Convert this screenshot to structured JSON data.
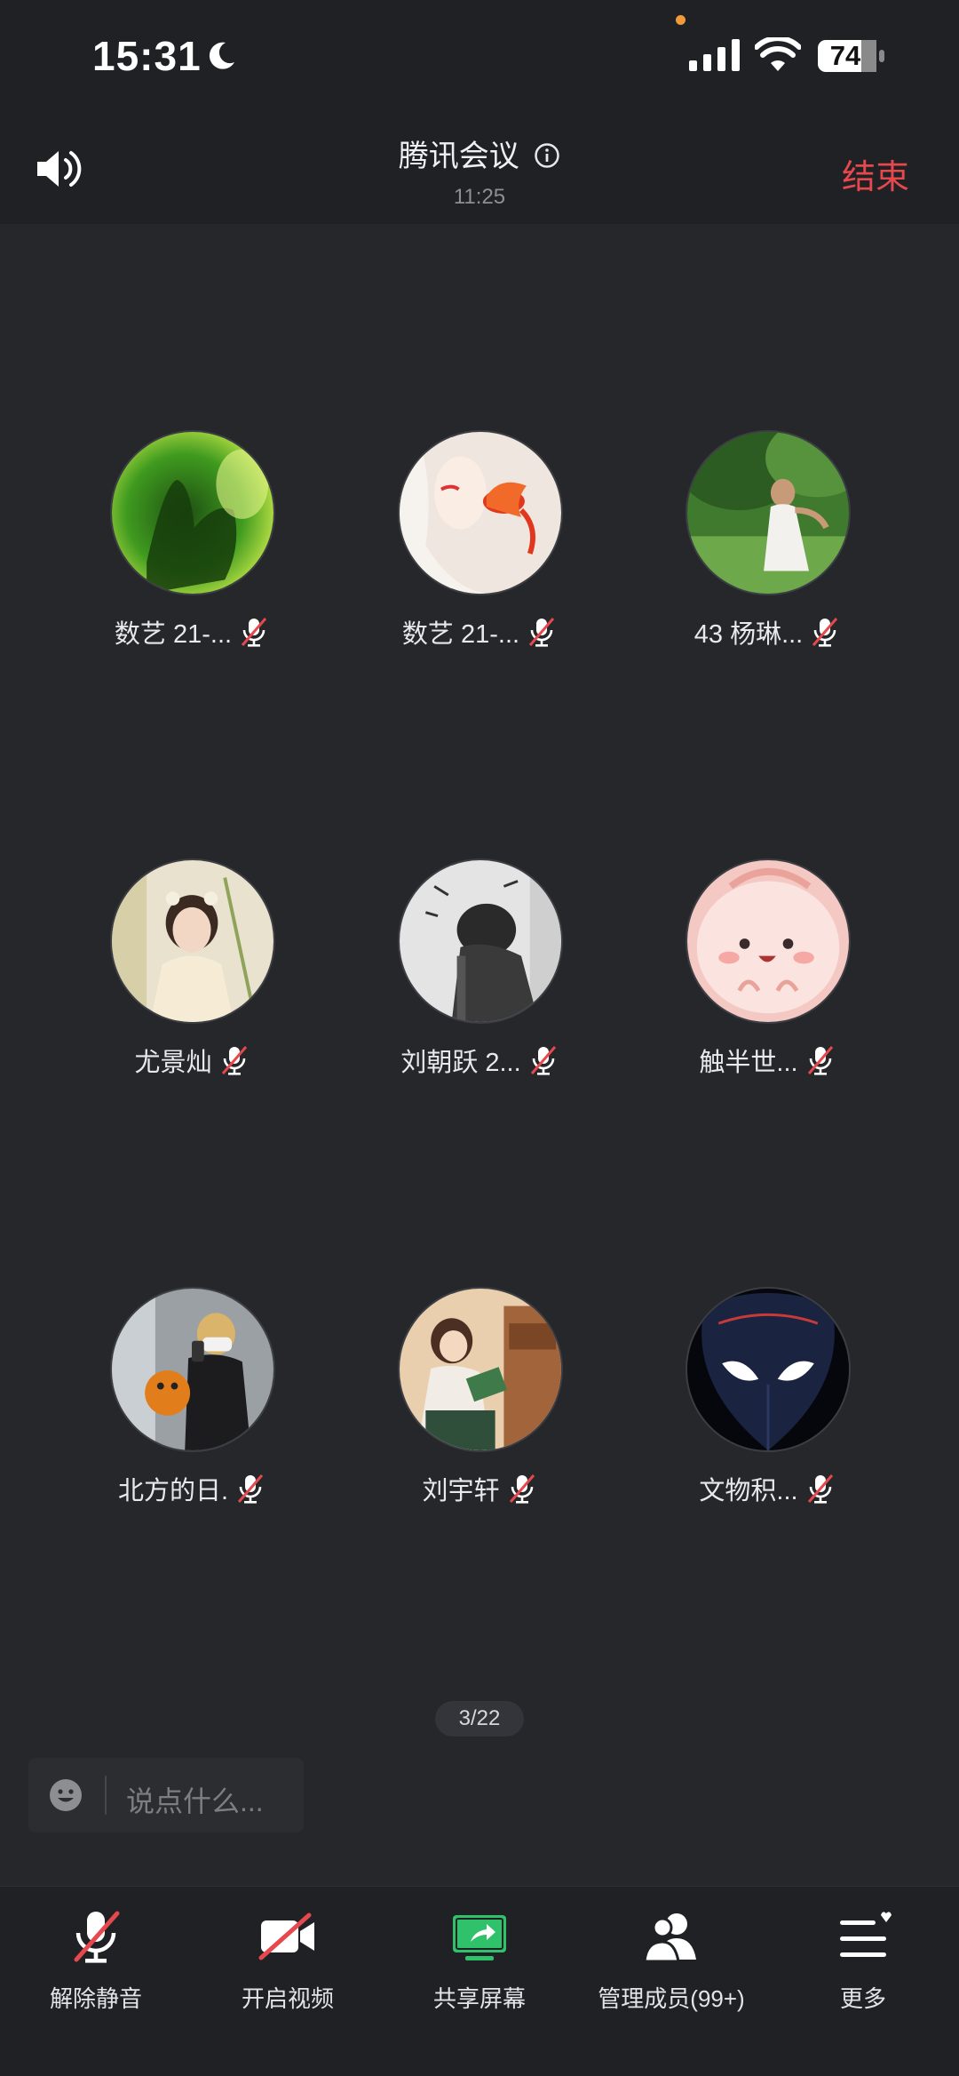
{
  "status_bar": {
    "time": "15:31",
    "battery": "74"
  },
  "header": {
    "title": "腾讯会议",
    "elapsed": "11:25",
    "end_label": "结束"
  },
  "participants": [
    {
      "name": "数艺 21-...",
      "muted": true
    },
    {
      "name": "数艺 21-...",
      "muted": true
    },
    {
      "name": "43 杨琳...",
      "muted": true
    },
    {
      "name": "尤景灿",
      "muted": true
    },
    {
      "name": "刘朝跃 2...",
      "muted": true
    },
    {
      "name": "触半世...",
      "muted": true
    },
    {
      "name": "北方的日.",
      "muted": true
    },
    {
      "name": "刘宇轩",
      "muted": true
    },
    {
      "name": "文物积...",
      "muted": true
    }
  ],
  "pager": "3/22",
  "chat": {
    "placeholder": "说点什么..."
  },
  "toolbar": {
    "unmute": "解除静音",
    "video": "开启视频",
    "share": "共享屏幕",
    "members": "管理成员(99+)",
    "more": "更多"
  },
  "colors": {
    "end": "#e5484d",
    "share": "#2fc26a",
    "mute_slash": "#e5484d"
  }
}
